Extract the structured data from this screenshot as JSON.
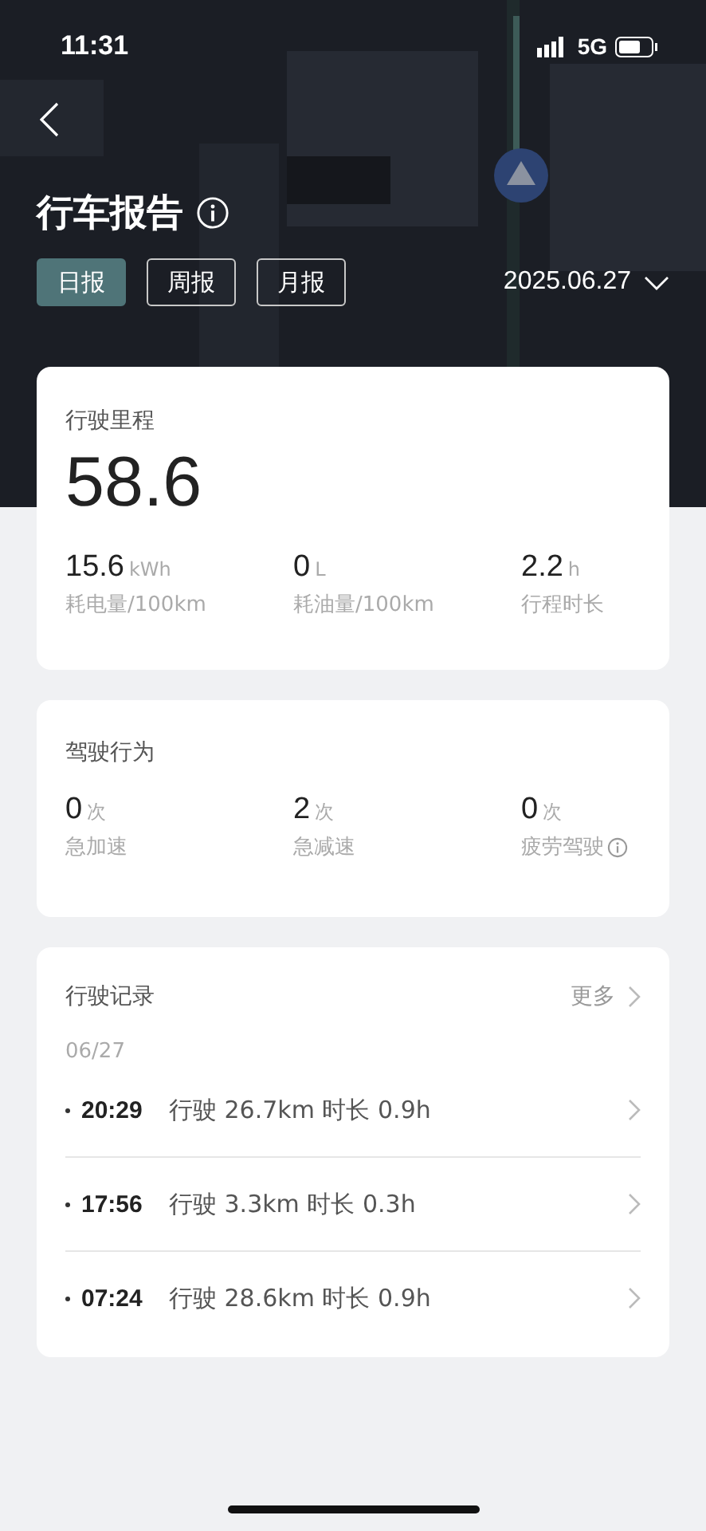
{
  "status_bar": {
    "time": "11:31",
    "network": "5G"
  },
  "header": {
    "title": "行车报告",
    "date": "2025.06.27"
  },
  "tabs": [
    {
      "label": "日报",
      "selected": true
    },
    {
      "label": "周报",
      "selected": false
    },
    {
      "label": "月报",
      "selected": false
    }
  ],
  "mileage": {
    "label": "行驶里程",
    "value": "58.6",
    "stats": [
      {
        "value": "15.6",
        "unit": "kWh",
        "label": "耗电量/100km",
        "info": false
      },
      {
        "value": "0",
        "unit": "L",
        "label": "耗油量/100km",
        "info": false
      },
      {
        "value": "2.2",
        "unit": "h",
        "label": "行程时长",
        "info": false
      }
    ]
  },
  "behavior": {
    "title": "驾驶行为",
    "stats": [
      {
        "value": "0",
        "unit": "次",
        "label": "急加速",
        "info": false
      },
      {
        "value": "2",
        "unit": "次",
        "label": "急减速",
        "info": false
      },
      {
        "value": "0",
        "unit": "次",
        "label": "疲劳驾驶",
        "info": true
      }
    ]
  },
  "records": {
    "title": "行驶记录",
    "more": "更多",
    "date": "06/27",
    "items": [
      {
        "time": "20:29",
        "detail": "行驶 26.7km 时长 0.9h"
      },
      {
        "time": "17:56",
        "detail": "行驶 3.3km 时长 0.3h"
      },
      {
        "time": "07:24",
        "detail": "行驶 28.6km 时长 0.9h"
      }
    ]
  }
}
